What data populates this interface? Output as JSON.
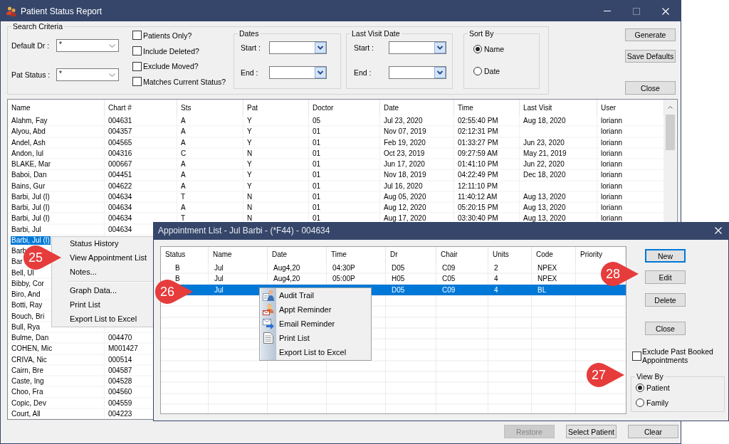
{
  "report_window": {
    "title": "Patient Status Report",
    "search_criteria": {
      "title": "Search Criteria",
      "fields": [
        {
          "label": "Default Dr :",
          "value": "*"
        },
        {
          "label": "Pat Status :",
          "value": "*"
        }
      ],
      "checkboxes": [
        {
          "label": "Patients Only?",
          "checked": false
        },
        {
          "label": "Include Deleted?",
          "checked": false
        },
        {
          "label": "Exclude Moved?",
          "checked": false
        },
        {
          "label": "Matches Current Status?",
          "checked": false
        }
      ],
      "date_groups": [
        {
          "title": "Dates",
          "start_label": "Start :",
          "end_label": "End :"
        },
        {
          "title": "Last Visit Date",
          "start_label": "Start :",
          "end_label": "End :"
        }
      ],
      "sort_by": {
        "title": "Sort By",
        "options": [
          {
            "label": "Name",
            "selected": true
          },
          {
            "label": "Date",
            "selected": false
          }
        ]
      }
    },
    "side_buttons": [
      {
        "label": "Generate"
      },
      {
        "label": "Save Defaults"
      },
      {
        "label": "Close"
      }
    ],
    "table": {
      "columns": [
        "Name",
        "Chart #",
        "Sts",
        "Pat",
        "Doctor",
        "Date",
        "Time",
        "Last Visit",
        "User"
      ],
      "rows": [
        {
          "name": "Alahm, Fay",
          "chart_no": "004631",
          "sts": "A",
          "pat": "Y",
          "doctor": "05",
          "date": "Jul 23, 2020",
          "time": "02:55:40 PM",
          "last_visit": "Aug 18, 2020",
          "user": "loriann",
          "selected": false
        },
        {
          "name": "Alyou, Abd",
          "chart_no": "004357",
          "sts": "A",
          "pat": "Y",
          "doctor": "01",
          "date": "Nov 07, 2019",
          "time": "02:12:31 PM",
          "user": "loriann",
          "selected": false
        },
        {
          "name": "Andel, Ash",
          "chart_no": "004565",
          "sts": "A",
          "pat": "Y",
          "doctor": "01",
          "date": "Feb 19, 2020",
          "time": "01:33:27 PM",
          "last_visit": "Jun 23, 2020",
          "user": "loriann",
          "selected": false
        },
        {
          "name": "Andon, Iul",
          "chart_no": "004316",
          "sts": "C",
          "pat": "N",
          "doctor": "01",
          "date": "Oct 23, 2019",
          "time": "09:27:59 AM",
          "last_visit": "May 21, 2019",
          "user": "loriann",
          "selected": false
        },
        {
          "name": "BLAKE, Mar",
          "chart_no": "000667",
          "sts": "A",
          "pat": "Y",
          "doctor": "01",
          "date": "Jun 17, 2020",
          "time": "01:41:10 PM",
          "last_visit": "Jun 22, 2020",
          "user": "loriann",
          "selected": false
        },
        {
          "name": "Baboi, Dan",
          "chart_no": "004451",
          "sts": "A",
          "pat": "Y",
          "doctor": "01",
          "date": "Nov 18, 2019",
          "time": "04:22:49 PM",
          "last_visit": "Dec 18, 2020",
          "user": "loriann",
          "selected": false
        },
        {
          "name": "Bains, Gur",
          "chart_no": "004622",
          "sts": "A",
          "pat": "Y",
          "doctor": "01",
          "date": "Jul 16, 2020",
          "time": "12:11:10 PM",
          "user": "loriann",
          "selected": false
        },
        {
          "name": "Barbi, Jul (I)",
          "chart_no": "004634",
          "sts": "T",
          "pat": "N",
          "doctor": "01",
          "date": "Aug 05, 2020",
          "time": "11:40:12 AM",
          "last_visit": "Aug 13, 2020",
          "user": "loriann",
          "selected": false
        },
        {
          "name": "Barbi, Jul (I)",
          "chart_no": "004634",
          "sts": "A",
          "pat": "N",
          "doctor": "01",
          "date": "Aug 12, 2020",
          "time": "05:20:15 PM",
          "last_visit": "Aug 13, 2020",
          "user": "loriann",
          "selected": false
        },
        {
          "name": "Barbi, Jul (I)",
          "chart_no": "004634",
          "sts": "T",
          "pat": "N",
          "doctor": "01",
          "date": "Aug 17, 2020",
          "time": "03:30:40 PM",
          "last_visit": "Aug 13, 2020",
          "user": "loriann",
          "selected": false
        },
        {
          "name": "Barbi, Jul",
          "chart_no": "004634",
          "selected": false
        },
        {
          "name": "Barbi, Jul (I)",
          "selected": true
        },
        {
          "name": "Barb",
          "selected": false
        },
        {
          "name": "Bar",
          "selected": false
        },
        {
          "name": "Bell, Ul",
          "selected": false
        },
        {
          "name": "Bibby, Cor",
          "selected": false
        },
        {
          "name": "Biro, And",
          "selected": false
        },
        {
          "name": "Botti, Ray",
          "selected": false
        },
        {
          "name": "Bouch, Bri",
          "selected": false
        },
        {
          "name": "Bull, Rya",
          "selected": false
        },
        {
          "name": "Bulme, Dan",
          "chart_no": "004470",
          "selected": false
        },
        {
          "name": "COHEN, Mic",
          "chart_no": "M001427",
          "selected": false
        },
        {
          "name": "CRIVA, Nic",
          "chart_no": "000514",
          "selected": false
        },
        {
          "name": "Cairn, Bre",
          "chart_no": "004587",
          "selected": false
        },
        {
          "name": "Caste, Ing",
          "chart_no": "004528",
          "selected": false
        },
        {
          "name": "Choo, Fra",
          "chart_no": "004560",
          "selected": false
        },
        {
          "name": "Copic, Dev",
          "chart_no": "004559",
          "selected": false
        },
        {
          "name": "Court, All",
          "chart_no": "004223",
          "selected": false
        }
      ]
    },
    "bottom_buttons": [
      {
        "label": "Restore",
        "disabled": true
      },
      {
        "label": "Select Patient",
        "disabled": false
      },
      {
        "label": "Clear",
        "disabled": false
      }
    ]
  },
  "row_menu": {
    "items": [
      {
        "kind": "item",
        "label": "Status History"
      },
      {
        "kind": "item",
        "label": "View Appointment List"
      },
      {
        "kind": "item",
        "label": "Notes..."
      },
      {
        "kind": "separator"
      },
      {
        "kind": "item",
        "label": "Graph Data..."
      },
      {
        "kind": "item",
        "label": "Print List"
      },
      {
        "kind": "item",
        "label": "Export List to Excel"
      }
    ]
  },
  "appointment_dialog": {
    "title": "Appointment List - Jul Barbi - (*F44) - 004634",
    "table": {
      "columns": [
        "Status",
        "Name",
        "Date",
        "Time",
        "Dr",
        "Chair",
        "Units",
        "Code",
        "Priority"
      ],
      "rows": [
        {
          "status": "B",
          "name": "Jul",
          "date": "Aug4,20",
          "time": "04:30P",
          "dr": "D05",
          "chair": "C09",
          "units": "2",
          "code": "NPEX",
          "selected": false
        },
        {
          "status": "B",
          "name": "Jul",
          "date": "Aug4,20",
          "time": "05:00P",
          "dr": "H05",
          "chair": "C05",
          "units": "4",
          "code": "NPEX",
          "selected": false
        },
        {
          "name": "Jul",
          "dr": "D05",
          "chair": "C09",
          "units": "4",
          "code": "BL",
          "selected": true
        }
      ]
    },
    "buttons": [
      {
        "label": "New",
        "focused": true
      },
      {
        "label": "Edit",
        "focused": false
      },
      {
        "label": "Delete",
        "focused": false
      },
      {
        "label": "Close",
        "focused": false
      }
    ],
    "exclude_past_booked": {
      "label": "Exclude Past Booked Appointments",
      "checked": false
    },
    "view_by": {
      "title": "View By",
      "options": [
        {
          "label": "Patient",
          "selected": true
        },
        {
          "label": "Family",
          "selected": false
        }
      ]
    }
  },
  "appointment_menu": {
    "items": [
      {
        "label": "Audit Trail"
      },
      {
        "label": "Appt Reminder"
      },
      {
        "label": "Email Reminder"
      },
      {
        "label": "Print List"
      },
      {
        "label": "Export List to Excel"
      }
    ]
  },
  "callouts": [
    {
      "label": "25"
    },
    {
      "label": "26"
    },
    {
      "label": "27"
    },
    {
      "label": "28"
    }
  ]
}
